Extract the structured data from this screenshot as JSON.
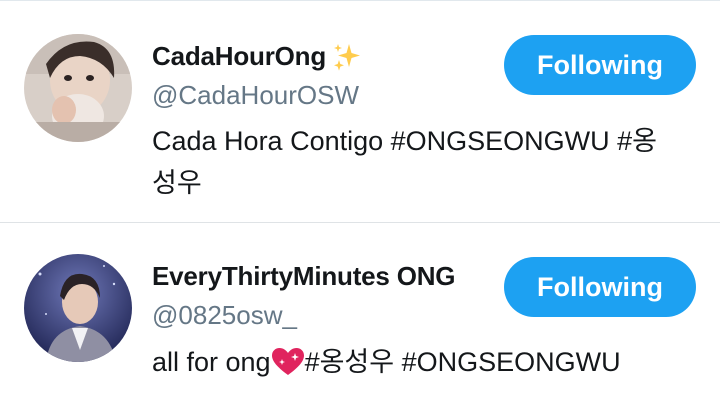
{
  "accounts": [
    {
      "display_name": "CadaHourOng",
      "badge_icon": "sparkles-icon",
      "handle": "@CadaHourOSW",
      "bio_line1": "Cada Hora Contigo #ONGSEONGWU #옹",
      "bio_line2": "성우",
      "follow_label": "Following"
    },
    {
      "display_name": "EveryThirtyMinutes ONG",
      "handle": "@0825osw_",
      "bio_before": "all for ong",
      "bio_icon": "sparkling-heart-icon",
      "bio_after": "#옹성우 #ONGSEONGWU",
      "follow_label": "Following"
    }
  ],
  "colors": {
    "accent": "#1da1f2",
    "text_primary": "#14171a",
    "text_secondary": "#657786",
    "divider": "#dfe3e6",
    "heart": "#e0245e",
    "sparkle": "#ffcc4d"
  }
}
